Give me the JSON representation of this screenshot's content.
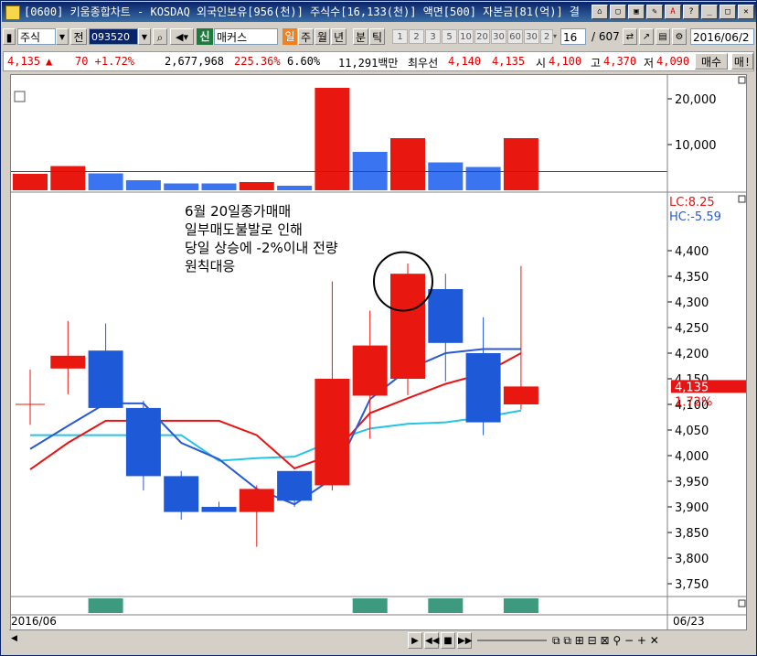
{
  "title_bar": {
    "text": "[0600] 키움종합차트 - KOSDAQ 외국인보유[956(천)] 주식수[16,133(천)] 액면[500] 자본금[81(억)] 결",
    "buttons": [
      "⌂",
      "▢",
      "▣",
      "✎",
      "A",
      "?",
      "_",
      "□",
      "✕"
    ]
  },
  "toolbar": {
    "market": "주식",
    "jeon": "전",
    "code": "093520",
    "stock_badge": "신",
    "stock_name": "매커스",
    "periods": [
      "일",
      "주",
      "월",
      "년",
      "분",
      "틱"
    ],
    "active_period": "일",
    "minute_options": [
      "1",
      "2",
      "3",
      "5",
      "10",
      "20",
      "30",
      "60",
      "30",
      "2"
    ],
    "count": "16",
    "total": "/ 607",
    "date": "2016/06/2"
  },
  "quote_bar": {
    "price": "4,135",
    "arrow": "▲",
    "change": "70 +1.72%",
    "volume": "2,677,968",
    "volume_ratio": "225.36%",
    "turnover": "6.60%",
    "amount": "11,291백만",
    "best_label": "최우선",
    "best_ask": "4,140",
    "best_bid": "4,135",
    "open_label": "시",
    "open": "4,100",
    "high_label": "고",
    "high": "4,370",
    "low_label": "저",
    "low": "4,090",
    "buy_button": "매수",
    "sell_button": "매!"
  },
  "chart_data": [
    {
      "type": "bar",
      "panel": "volume",
      "y_ticks": [
        "20,000",
        "10,000"
      ],
      "ylim": [
        0,
        24000
      ],
      "values": [
        3600,
        5300,
        3700,
        2200,
        1500,
        1500,
        1800,
        1000,
        22400,
        8400,
        11400,
        6100,
        5100,
        11400
      ],
      "directions": [
        "up",
        "up",
        "down",
        "down",
        "down",
        "down",
        "up",
        "down",
        "up",
        "down",
        "up",
        "down",
        "down",
        "up"
      ],
      "ref_line": 5300
    },
    {
      "type": "candlestick",
      "panel": "price",
      "ylim": [
        3700,
        4450
      ],
      "y_ticks": [
        "4,400",
        "4,350",
        "4,300",
        "4,250",
        "4,200",
        "4,150",
        "4,100",
        "4,050",
        "4,000",
        "3,950",
        "3,900",
        "3,850",
        "3,800",
        "3,750"
      ],
      "candles": [
        {
          "o": 4163,
          "h": 4168,
          "l": 4060,
          "c": 4100,
          "type": "cross"
        },
        {
          "o": 4170,
          "h": 4263,
          "l": 4120,
          "c": 4195
        },
        {
          "o": 4205,
          "h": 4258,
          "l": 4093,
          "c": 4093
        },
        {
          "o": 4093,
          "h": 4107,
          "l": 3932,
          "c": 3960
        },
        {
          "o": 3960,
          "h": 3970,
          "l": 3875,
          "c": 3890
        },
        {
          "o": 3900,
          "h": 3910,
          "l": 3890,
          "c": 3890
        },
        {
          "o": 3890,
          "h": 3942,
          "l": 3822,
          "c": 3935
        },
        {
          "o": 3970,
          "h": 3970,
          "l": 3900,
          "c": 3912
        },
        {
          "o": 3942,
          "h": 4340,
          "l": 3932,
          "c": 4150
        },
        {
          "o": 4117,
          "h": 4283,
          "l": 4033,
          "c": 4215
        },
        {
          "o": 4150,
          "h": 4375,
          "l": 4118,
          "c": 4355
        },
        {
          "o": 4325,
          "h": 4355,
          "l": 4145,
          "c": 4220
        },
        {
          "o": 4200,
          "h": 4270,
          "l": 4040,
          "c": 4065
        },
        {
          "o": 4100,
          "h": 4370,
          "l": 4090,
          "c": 4135
        }
      ],
      "ma_red": [
        3973,
        4025,
        4068,
        4068,
        4068,
        4068,
        4040,
        3975,
        4002,
        4083,
        4112,
        4140,
        4160,
        4200
      ],
      "ma_blue": [
        4013,
        4058,
        4102,
        4102,
        4025,
        3993,
        3935,
        3905,
        3955,
        4110,
        4168,
        4200,
        4208,
        4208
      ],
      "ma_cyan": [
        4040,
        4040,
        4040,
        4040,
        4040,
        3990,
        3995,
        3998,
        4028,
        4053,
        4062,
        4065,
        4075,
        4088
      ],
      "annotation": [
        "6월 20일종가매매",
        "일부매도불발로 인해",
        "당일 상승에 -2%이내 전량",
        "원칙대응"
      ],
      "lc_label": "LC:8.25",
      "hc_label": "HC:-5.59",
      "price_tag": "4,135",
      "change_tag": "1.72%"
    }
  ],
  "signal_strip": [
    false,
    false,
    true,
    false,
    false,
    false,
    false,
    false,
    false,
    true,
    false,
    true,
    false,
    true
  ],
  "bottom": {
    "date_left": "2016/06",
    "date_right": "06/23"
  },
  "colors": {
    "up": "#e8170f",
    "down": "#1e5ad8",
    "volume_down": "#3a74f0",
    "ma_red": "#e81414",
    "ma_blue": "#2a59d6",
    "ma_cyan": "#24c4e4",
    "signal": "#3e9a7e"
  }
}
